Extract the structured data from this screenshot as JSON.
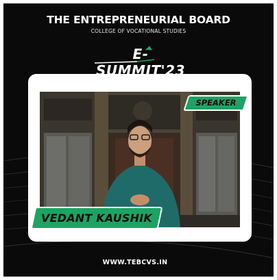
{
  "header": {
    "title": "THE ENTREPRENEURIAL BOARD",
    "subtitle": "COLLEGE OF VOCATIONAL STUDIES"
  },
  "logo": {
    "text": "E-SUMMIT'23"
  },
  "speaker_card": {
    "role_label": "SPEAKER",
    "name": "VEDANT KAUSHIK"
  },
  "footer": {
    "website": "WWW.TEBCVS.IN"
  },
  "colors": {
    "background": "#0a0a0a",
    "accent_green": "#1da363",
    "card": "#ffffff"
  }
}
